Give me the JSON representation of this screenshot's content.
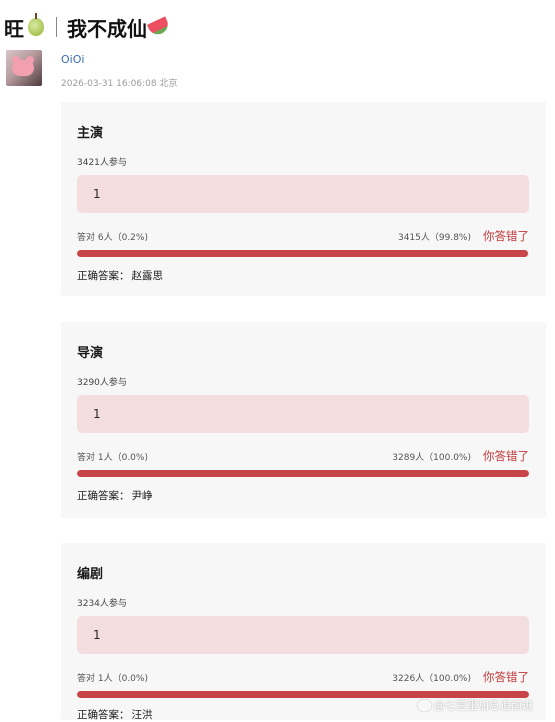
{
  "header": {
    "left_text": "旺",
    "pear_icon": "pear-emoji",
    "title": "我不成仙",
    "melon_icon": "watermelon-emoji"
  },
  "post": {
    "user_name": "OiOi",
    "meta": "2026-03-31 16:06:08 北京"
  },
  "quizzes": [
    {
      "title": "主演",
      "participants": "3421人参与",
      "user_answer": "1",
      "correct_stat": "答对 6人（0.2%)",
      "wrong_stat": "3415人（99.8%)",
      "wrong_fraction": 0.998,
      "result_label": "你答错了",
      "correct_label": "正确答案：",
      "correct_answer": "赵露思"
    },
    {
      "title": "导演",
      "participants": "3290人参与",
      "user_answer": "1",
      "correct_stat": "答对 1人（0.0%)",
      "wrong_stat": "3289人（100.0%)",
      "wrong_fraction": 1.0,
      "result_label": "你答错了",
      "correct_label": "正确答案：",
      "correct_answer": "尹峥"
    },
    {
      "title": "编剧",
      "participants": "3234人参与",
      "user_answer": "1",
      "correct_stat": "答对 1人（0.0%)",
      "wrong_stat": "3226人（100.0%)",
      "wrong_fraction": 1.0,
      "result_label": "你答错了",
      "correct_label": "正确答案：",
      "correct_answer": "汪洪"
    }
  ],
  "watermark": {
    "text": "@七宫里加急追前进",
    "icon": "weibo-icon"
  },
  "colors": {
    "card_bg": "#f7f7f7",
    "answer_bg": "#f4dddf",
    "accent_red": "#c64548",
    "link_blue": "#3a6fb0"
  }
}
